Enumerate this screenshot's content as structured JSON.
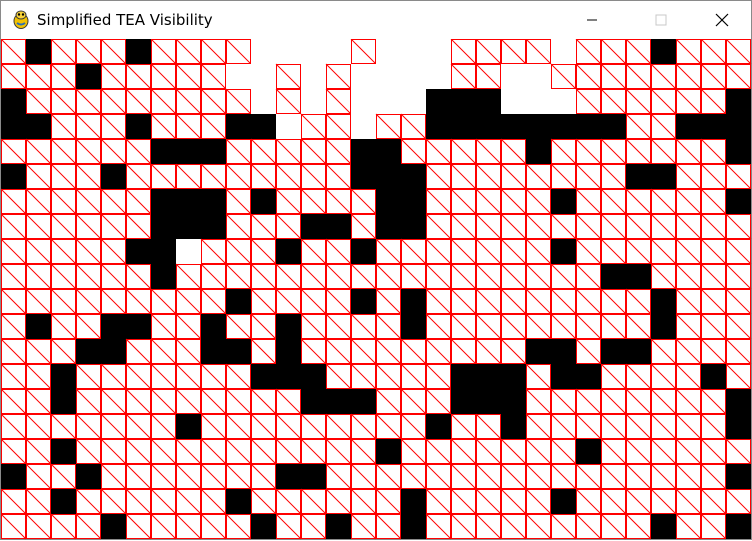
{
  "window": {
    "title": "Simplified TEA Visibility",
    "icon": "pygame-snake-icon",
    "controls": [
      "minimize-icon",
      "maximize-icon",
      "close-icon"
    ]
  },
  "grid": {
    "cols": 30,
    "rows": 20,
    "colors": {
      "wall": "#000000",
      "floor": "#ffffff",
      "visibility_lines": "#ff0000"
    },
    "cells": [
      "0100010000WWWW0WWW0000W000100001",
      "000100000WW0W0WWWW00WW000000000",
      "1000000000W0W0WWW111WWW000000100",
      "11000100011W00W0011111111001110011",
      "0000001110000011000001000000011",
      "100010000000001110000000011000101",
      "000000111010000110000010000001110",
      "00000011100011011000000000000011",
      "0000011W00010010000000100000001",
      "00000010000000000000000011000001",
      "000000000100001010000000001000100",
      "01001100100100001000000000100000",
      "00011000110100000000011011000000",
      "0010000000111000001110110000101",
      "001000000000111000111000000001",
      "000000010000000001001000000001",
      "001000000000000100000001000000001",
      "100100000001100000000000000001",
      "001000000100000010000010000000",
      "000010000010010010000000001001"
    ]
  }
}
